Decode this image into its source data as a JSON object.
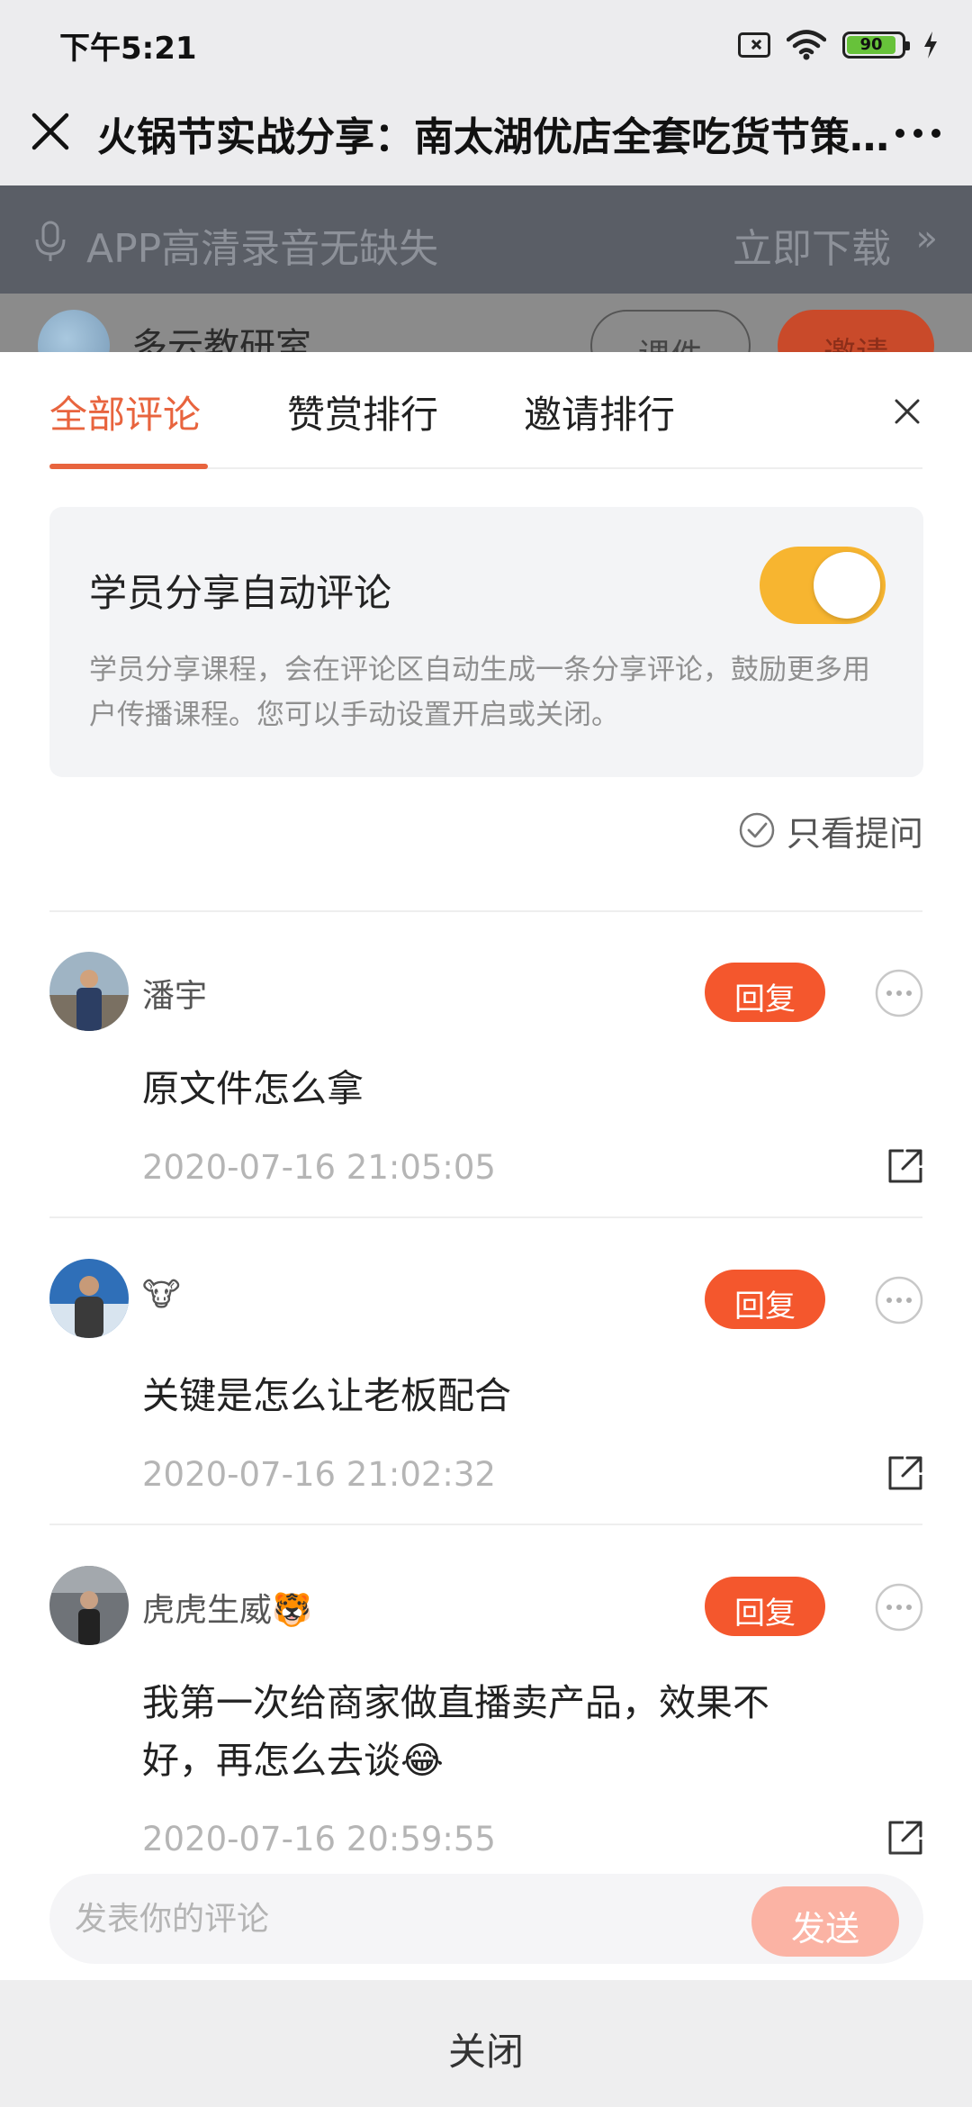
{
  "status_bar": {
    "time": "下午5:21",
    "battery_level": "90",
    "battery_percent": 90
  },
  "title_bar": {
    "title": "火锅节实战分享：南太湖优店全套吃货节策划方案"
  },
  "background_page": {
    "banner_text": "APP高清录音无缺失",
    "banner_download": "立即下载",
    "banner_arrow": "»",
    "course_author": "多云教研室",
    "course_button": "课件",
    "invite_button": "邀请"
  },
  "tabs": [
    {
      "label": "全部评论",
      "active": true
    },
    {
      "label": "赞赏排行",
      "active": false
    },
    {
      "label": "邀请排行",
      "active": false
    }
  ],
  "auto_comment": {
    "title": "学员分享自动评论",
    "description": "学员分享课程，会在评论区自动生成一条分享评论，鼓励更多用户传播课程。您可以手动设置开启或关闭。",
    "enabled": true
  },
  "filter": {
    "questions_only_label": "只看提问"
  },
  "comments": [
    {
      "user": "潘宇",
      "text": "原文件怎么拿",
      "time": "2020-07-16 21:05:05",
      "reply_label": "回复"
    },
    {
      "user": "🐮",
      "text": "关键是怎么让老板配合",
      "time": "2020-07-16 21:02:32",
      "reply_label": "回复"
    },
    {
      "user": "虎虎生威🐯",
      "text": "我第一次给商家做直播卖产品，效果不好，再怎么去谈😂",
      "time": "2020-07-16 20:59:55",
      "reply_label": "回复"
    }
  ],
  "composer": {
    "placeholder": "发表你的评论",
    "send_label": "发送"
  },
  "footer": {
    "close_label": "关闭"
  },
  "colors": {
    "accent": "#e8643e",
    "reply": "#f4572d",
    "toggle": "#f7b530",
    "send_disabled": "#fbb3a4"
  }
}
